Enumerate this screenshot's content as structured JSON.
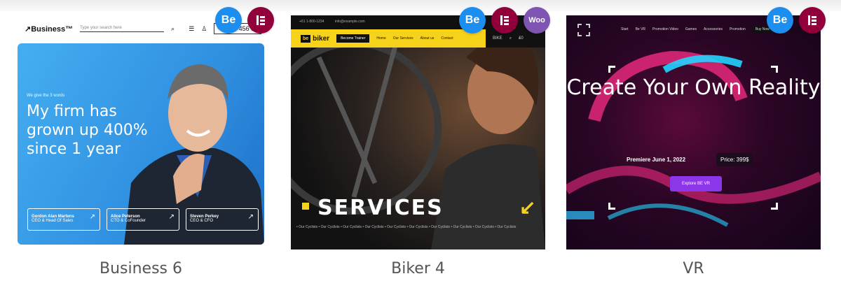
{
  "cards": [
    {
      "title": "Business 6",
      "badges": [
        "Be",
        "elementor-icon"
      ],
      "nav": {
        "logo": "↗Business™",
        "search_placeholder": "Type your search here",
        "phone": "+3 123 456 80"
      },
      "hero": {
        "eyebrow": "We give the 3 words",
        "headline": "My firm has grown up 400% since 1 year",
        "buttons": [
          {
            "name": "Gordon Alan Martens",
            "sub": "CEO & Head Of Sales"
          },
          {
            "name": "Alice Peterson",
            "sub": "CTO & CoFounder"
          },
          {
            "name": "Steven Perkey",
            "sub": "CEO & CFO"
          }
        ]
      }
    },
    {
      "title": "Biker 4",
      "badges": [
        "Be",
        "elementor-icon",
        "Woo"
      ],
      "topbar": {
        "phone": "+61 1-800-1234",
        "email": "info@example.com"
      },
      "nav": {
        "logo_mark": "be",
        "logo_text": "biker",
        "button": "Become Trainer",
        "items": [
          "Home",
          "Our Services",
          "About us",
          "Contact"
        ],
        "right_items": [
          "BIKE",
          "₤0"
        ]
      },
      "hero": {
        "headline": "SERVICES",
        "ticker": "• Our Cyclists  • Our Cyclists  • Our Cyclists  • Our Cyclists  • Our Cyclists  • Our Cyclists  • Our Cyclists  • Our Cyclists  • Our Cyclists  • Our Cyclists"
      }
    },
    {
      "title": "VR",
      "badges": [
        "Be",
        "elementor-icon"
      ],
      "nav": {
        "items": [
          "Start",
          "Be VR",
          "Promotion Video",
          "Games",
          "Accessories",
          "Promotion"
        ],
        "button": "Buy Now"
      },
      "hero": {
        "headline": "Create Your Own Reality",
        "premiere": "Premiere June 1, 2022",
        "price": "Price: 399$",
        "cta": "Explore BE VR"
      }
    }
  ],
  "colors": {
    "be_badge": "#1c8ef0",
    "elementor_badge": "#92003b",
    "woo_badge": "#7f54b3",
    "biker_yellow": "#f7d21a",
    "vr_purple": "#8b36e8"
  }
}
